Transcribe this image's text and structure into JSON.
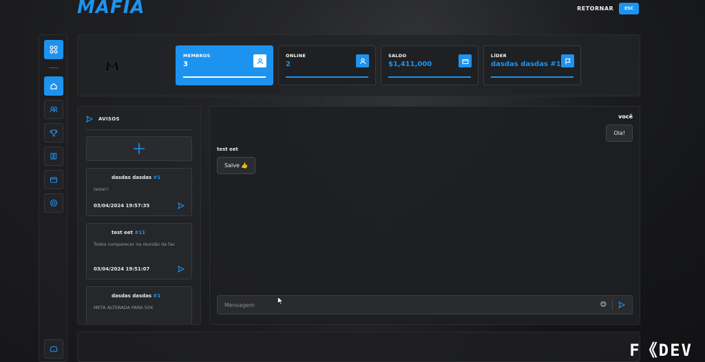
{
  "app": {
    "brand": "MAFIA",
    "retornar_label": "RETORNAR",
    "esc_label": "ESC",
    "accent_color": "#1d93f0"
  },
  "sidebar": {
    "items": [
      {
        "icon": "grid-icon",
        "active": true
      },
      {
        "icon": "home-icon",
        "active": true
      },
      {
        "icon": "members-icon",
        "active": false
      },
      {
        "icon": "trophy-icon",
        "active": false
      },
      {
        "icon": "books-icon",
        "active": false
      },
      {
        "icon": "wallet-icon",
        "active": false
      },
      {
        "icon": "target-icon",
        "active": false
      },
      {
        "icon": "discord-icon",
        "active": false
      }
    ]
  },
  "stats": [
    {
      "label": "MEMBROS",
      "value": "3",
      "icon": "user-icon",
      "active": true
    },
    {
      "label": "ONLINE",
      "value": "2",
      "icon": "user-icon",
      "active": false
    },
    {
      "label": "SALDO",
      "value": "$1,411,000",
      "icon": "wallet-icon",
      "active": false
    },
    {
      "label": "LÍDER",
      "value": "dasdas dasdas #1",
      "icon": "flag-icon",
      "active": false
    }
  ],
  "notices": {
    "title": "AVISOS",
    "items": [
      {
        "author": "dasdas dasdas",
        "id": "#1",
        "message": "teste!!",
        "timestamp": "03/04/2024 19:57:35"
      },
      {
        "author": "test eet",
        "id": "#11",
        "message": "Todos comparecer na reunião da fac",
        "timestamp": "03/04/2024 19:51:07"
      },
      {
        "author": "dasdas dasdas",
        "id": "#1",
        "message": "META ALTERADA PARA 50X",
        "timestamp": ""
      }
    ]
  },
  "chat": {
    "me_label": "você",
    "me_message": "Ola!",
    "other_name": "test eet",
    "other_message": "Salve 👍",
    "placeholder": "Mensagem"
  },
  "watermark": "F《DEV"
}
